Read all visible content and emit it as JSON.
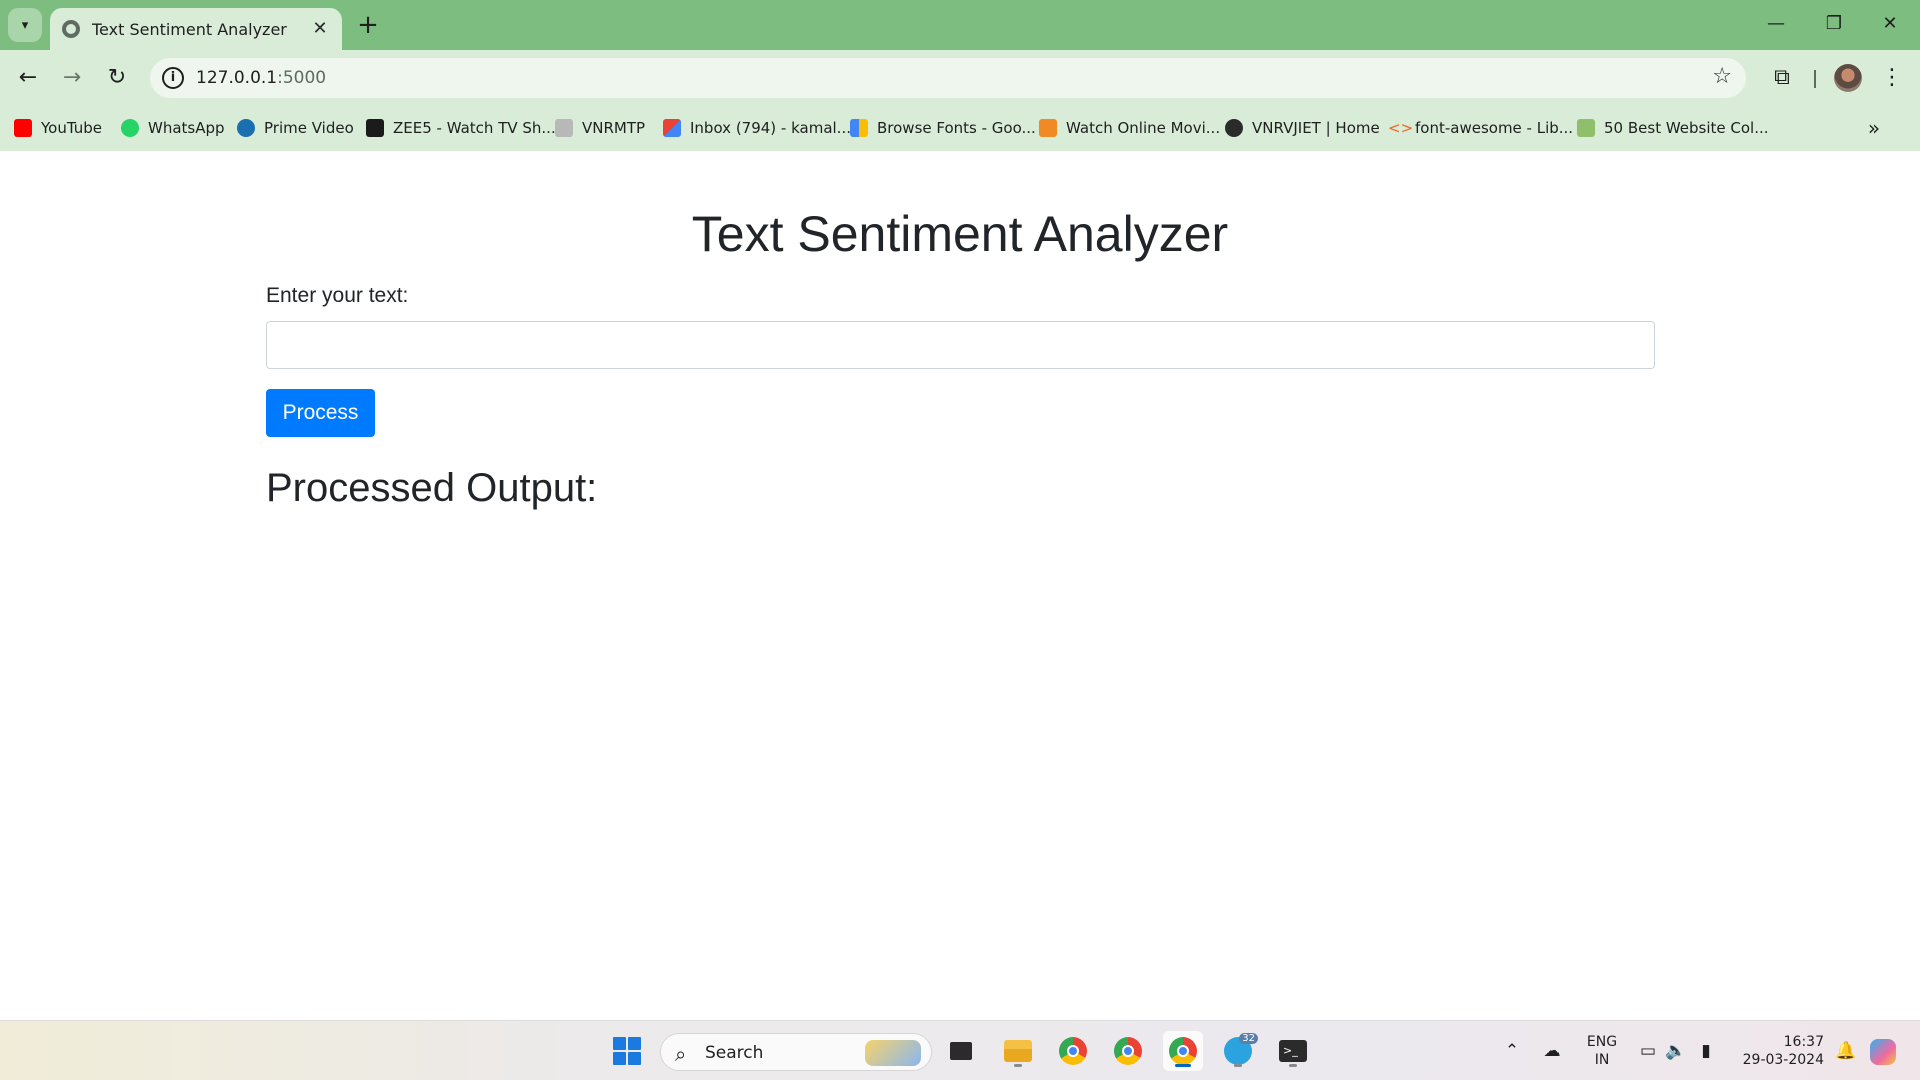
{
  "browser": {
    "tab_title": "Text Sentiment Analyzer",
    "tab_close": "✕",
    "new_tab": "+",
    "url_host": "127.0.0.1",
    "url_port": ":5000",
    "window_controls": {
      "minimize": "—",
      "restore": "❐",
      "close": "✕"
    },
    "nav": {
      "back": "←",
      "forward": "→",
      "reload": "↻"
    },
    "bookmarks": [
      {
        "label": "YouTube",
        "icon": "youtube-icon",
        "color": "#ff0000"
      },
      {
        "label": "WhatsApp",
        "icon": "whatsapp-icon",
        "color": "#25d366"
      },
      {
        "label": "Prime Video",
        "icon": "prime-video-icon",
        "color": "#1a6fb0"
      },
      {
        "label": "ZEE5 - Watch TV Sh...",
        "icon": "zee5-icon",
        "color": "#1b1b1b"
      },
      {
        "label": "VNRMTP",
        "icon": "vnrmtp-icon",
        "color": "#9a9a9a"
      },
      {
        "label": "Inbox (794) - kamal...",
        "icon": "gmail-icon",
        "color": "#ea4335"
      },
      {
        "label": "Browse Fonts - Goo...",
        "icon": "google-fonts-icon",
        "color": "#4285f4"
      },
      {
        "label": "Watch Online Movi...",
        "icon": "movies-icon",
        "color": "#f08a24"
      },
      {
        "label": "VNRVJIET | Home",
        "icon": "vnrvjiet-icon",
        "color": "#2b2b2b"
      },
      {
        "label": "font-awesome - Lib...",
        "icon": "code-icon",
        "color": "#f26522"
      },
      {
        "label": "50 Best Website Col...",
        "icon": "design-icon",
        "color": "#8fbf6a"
      }
    ],
    "bookmarks_more": "»"
  },
  "page": {
    "title": "Text Sentiment Analyzer",
    "input_label": "Enter your text:",
    "input_value": "",
    "button_label": "Process",
    "output_heading": "Processed Output:"
  },
  "taskbar": {
    "search_label": "Search",
    "language": "ENG",
    "region": "IN",
    "time": "16:37",
    "date": "29-03-2024",
    "telegram_badge": "32"
  },
  "colors": {
    "chrome_frame": "#7dbd7f",
    "chrome_toolbar": "#d8ecd8",
    "primary_button": "#007bff",
    "text_dark": "#212529"
  }
}
